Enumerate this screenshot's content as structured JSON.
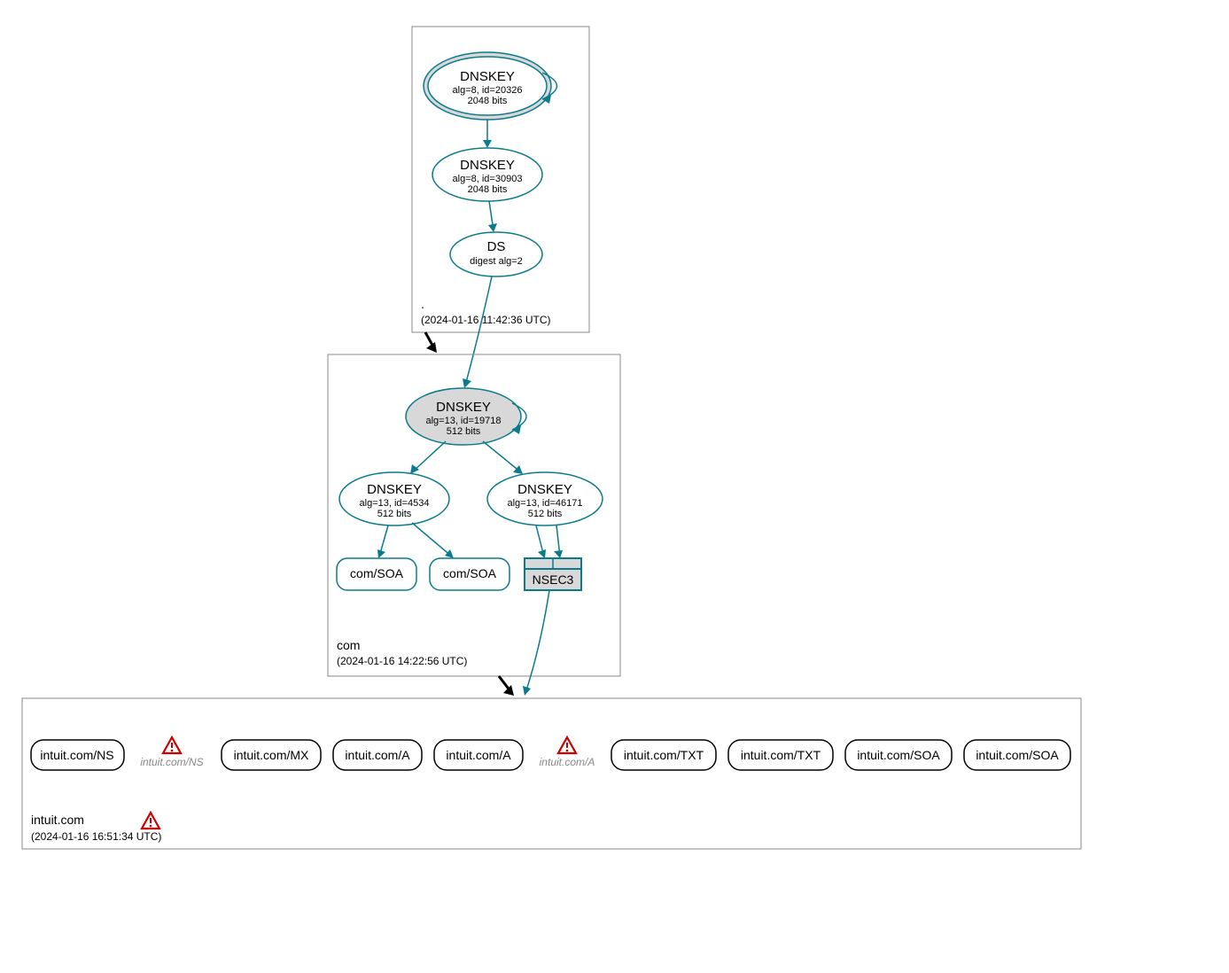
{
  "zones": {
    "root": {
      "name": ".",
      "timestamp": "(2024-01-16 11:42:36 UTC)",
      "nodes": {
        "ksk": {
          "title": "DNSKEY",
          "sub1": "alg=8, id=20326",
          "sub2": "2048 bits"
        },
        "zsk": {
          "title": "DNSKEY",
          "sub1": "alg=8, id=30903",
          "sub2": "2048 bits"
        },
        "ds": {
          "title": "DS",
          "sub1": "digest alg=2"
        }
      }
    },
    "com": {
      "name": "com",
      "timestamp": "(2024-01-16 14:22:56 UTC)",
      "nodes": {
        "ksk": {
          "title": "DNSKEY",
          "sub1": "alg=13, id=19718",
          "sub2": "512 bits"
        },
        "zsk1": {
          "title": "DNSKEY",
          "sub1": "alg=13, id=4534",
          "sub2": "512 bits"
        },
        "zsk2": {
          "title": "DNSKEY",
          "sub1": "alg=13, id=46171",
          "sub2": "512 bits"
        },
        "soa1": "com/SOA",
        "soa2": "com/SOA",
        "nsec3": "NSEC3"
      }
    },
    "intuit": {
      "name": "intuit.com",
      "timestamp": "(2024-01-16 16:51:34 UTC)",
      "records": [
        {
          "label": "intuit.com/NS",
          "warn": false
        },
        {
          "label": "intuit.com/NS",
          "warn": true
        },
        {
          "label": "intuit.com/MX",
          "warn": false
        },
        {
          "label": "intuit.com/A",
          "warn": false
        },
        {
          "label": "intuit.com/A",
          "warn": false
        },
        {
          "label": "intuit.com/A",
          "warn": true
        },
        {
          "label": "intuit.com/TXT",
          "warn": false
        },
        {
          "label": "intuit.com/TXT",
          "warn": false
        },
        {
          "label": "intuit.com/SOA",
          "warn": false
        },
        {
          "label": "intuit.com/SOA",
          "warn": false
        }
      ]
    }
  }
}
